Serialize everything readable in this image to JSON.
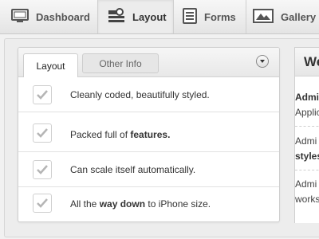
{
  "nav": {
    "items": [
      {
        "label": "Dashboard",
        "icon": "monitor-icon"
      },
      {
        "label": "Layout",
        "icon": "layout-icon",
        "active": true
      },
      {
        "label": "Forms",
        "icon": "forms-icon"
      },
      {
        "label": "Gallery",
        "icon": "gallery-icon"
      }
    ]
  },
  "panel": {
    "tabs": [
      {
        "label": "Layout",
        "active": true
      },
      {
        "label": "Other Info",
        "active": false
      }
    ],
    "rows": [
      {
        "parts": [
          {
            "text": "Cleanly coded, beautifully styled.",
            "bold": false
          }
        ]
      },
      {
        "parts": [
          {
            "text": "Packed full of ",
            "bold": false
          },
          {
            "text": "features.",
            "bold": true
          }
        ]
      },
      {
        "parts": [
          {
            "text": "Can scale itself automatically.",
            "bold": false
          }
        ]
      },
      {
        "parts": [
          {
            "text": "All the ",
            "bold": false
          },
          {
            "text": "way down",
            "bold": true
          },
          {
            "text": " to iPhone size.",
            "bold": false
          }
        ]
      }
    ]
  },
  "side": {
    "title": "We",
    "lines": [
      {
        "text": "Admi",
        "bold": true
      },
      {
        "text": "Applic",
        "bold": false
      },
      {
        "text": "Admi",
        "bold": false
      },
      {
        "text": "styles",
        "bold": true
      },
      {
        "text": "Admi",
        "bold": false
      },
      {
        "text": "works",
        "bold": false
      }
    ]
  },
  "colors": {
    "check": "#b5b5b5",
    "text": "#333333"
  }
}
